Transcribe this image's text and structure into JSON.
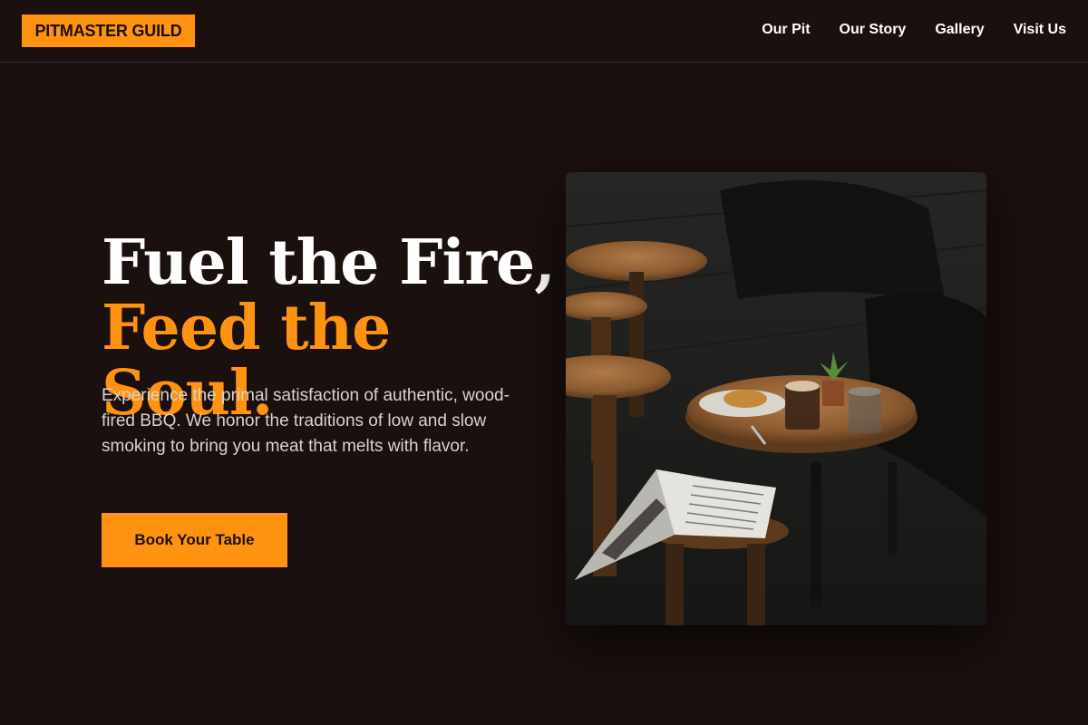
{
  "header": {
    "logo": "PITMASTER GUILD",
    "nav": [
      "Our Pit",
      "Our Story",
      "Gallery",
      "Visit Us"
    ]
  },
  "hero": {
    "headline_line1": "Fuel the Fire,",
    "headline_line2": "Feed the Soul.",
    "description": "Experience the primal satisfaction of authentic, wood-fired BBQ. We honor the traditions of low and slow smoking to bring you meat that melts with flavor.",
    "cta_label": "Book Your Table"
  },
  "colors": {
    "background": "#1a100e",
    "accent": "#ff9210",
    "text": "#ffffff",
    "muted_text": "#d9d2cf"
  }
}
